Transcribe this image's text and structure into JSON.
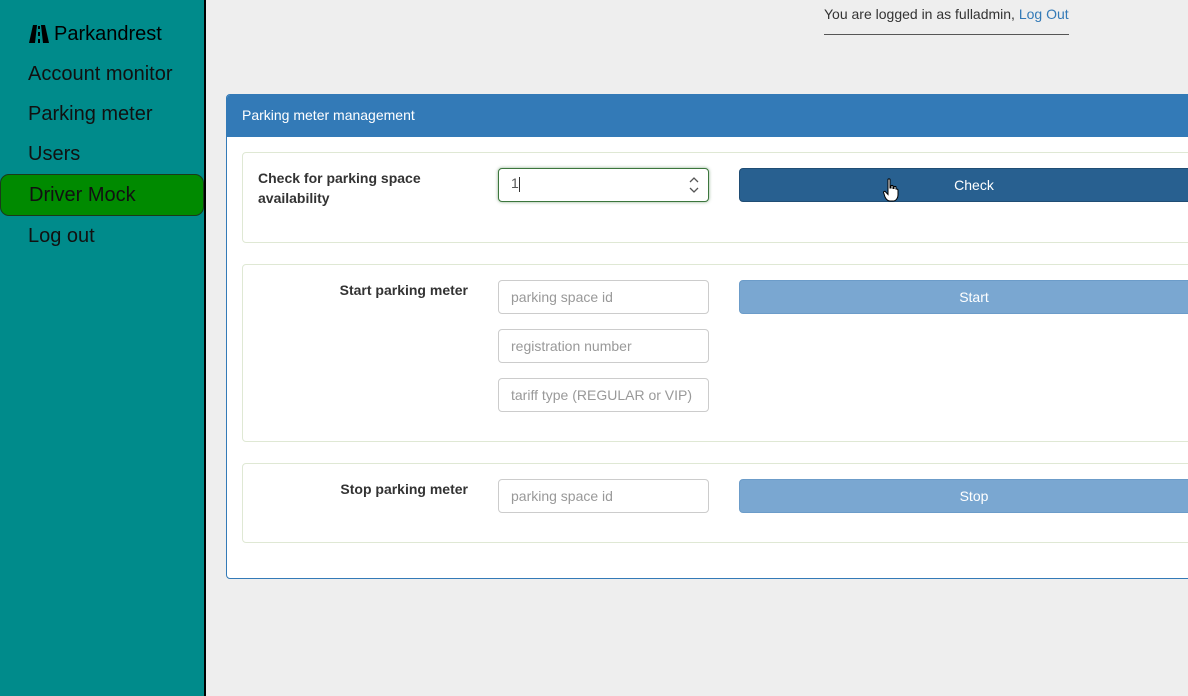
{
  "sidebar": {
    "brand": "Parkandrest",
    "items": [
      {
        "label": "Account monitor"
      },
      {
        "label": "Parking meter"
      },
      {
        "label": "Users"
      },
      {
        "label": "Driver Mock"
      },
      {
        "label": "Log out"
      }
    ]
  },
  "userbar": {
    "text": "You are logged in as fulladmin, ",
    "logout_link": "Log Out"
  },
  "panel": {
    "title": "Parking meter management",
    "check": {
      "label_line1": "Check for parking space",
      "label_line2": "availability",
      "input_value": "1",
      "button": "Check"
    },
    "start": {
      "label": "Start parking meter",
      "space_placeholder": "parking space id",
      "registration_placeholder": "registration number",
      "tariff_placeholder": "tariff type (REGULAR or VIP)",
      "button": "Start"
    },
    "stop": {
      "label": "Stop parking meter",
      "space_placeholder": "parking space id",
      "button": "Stop"
    }
  },
  "colors": {
    "sidebar_bg": "#008b8b",
    "active_nav_bg": "#008a00",
    "panel_primary": "#337ab7",
    "btn_active": "#286090",
    "btn_disabled": "#7aa7d1"
  },
  "icons": {
    "brand": "road-icon",
    "cursor": "hand-pointer-icon",
    "spinner": "number-spinner-icon"
  }
}
